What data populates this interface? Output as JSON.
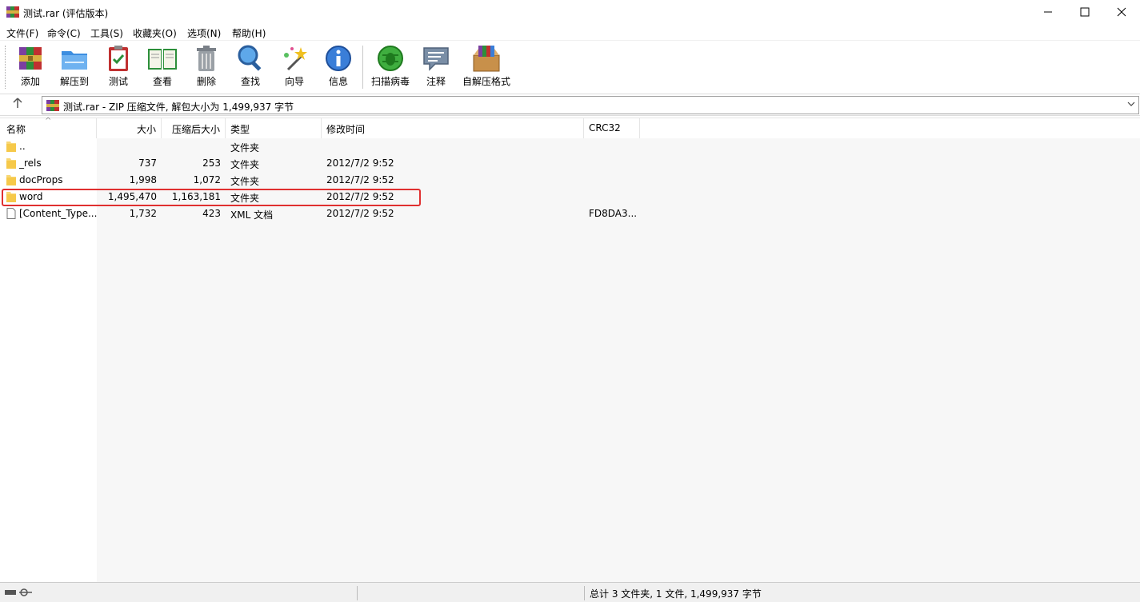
{
  "window": {
    "title": "测试.rar (评估版本)"
  },
  "menu": [
    {
      "label": "文件(F)"
    },
    {
      "label": "命令(C)"
    },
    {
      "label": "工具(S)"
    },
    {
      "label": "收藏夹(O)"
    },
    {
      "label": "选项(N)"
    },
    {
      "label": "帮助(H)"
    }
  ],
  "toolbar": [
    {
      "label": "添加",
      "icon": "add-archive-icon"
    },
    {
      "label": "解压到",
      "icon": "extract-folder-icon"
    },
    {
      "label": "测试",
      "icon": "test-clipboard-icon"
    },
    {
      "label": "查看",
      "icon": "view-book-icon"
    },
    {
      "label": "删除",
      "icon": "trash-icon"
    },
    {
      "label": "查找",
      "icon": "magnifier-icon"
    },
    {
      "label": "向导",
      "icon": "wizard-wand-icon"
    },
    {
      "label": "信息",
      "icon": "info-icon"
    },
    {
      "label": "扫描病毒",
      "icon": "virus-scan-icon"
    },
    {
      "label": "注释",
      "icon": "comment-icon"
    },
    {
      "label": "自解压格式",
      "icon": "sfx-box-icon"
    }
  ],
  "address": {
    "text": "测试.rar - ZIP 压缩文件, 解包大小为 1,499,937 字节"
  },
  "columns": {
    "name": "名称",
    "size": "大小",
    "packed": "压缩后大小",
    "type": "类型",
    "modified": "修改时间",
    "crc": "CRC32"
  },
  "rows": [
    {
      "name": "..",
      "size": "",
      "packed": "",
      "type": "文件夹",
      "modified": "",
      "crc": "",
      "kind": "folder"
    },
    {
      "name": "_rels",
      "size": "737",
      "packed": "253",
      "type": "文件夹",
      "modified": "2012/7/2 9:52",
      "crc": "",
      "kind": "folder"
    },
    {
      "name": "docProps",
      "size": "1,998",
      "packed": "1,072",
      "type": "文件夹",
      "modified": "2012/7/2 9:52",
      "crc": "",
      "kind": "folder"
    },
    {
      "name": "word",
      "size": "1,495,470",
      "packed": "1,163,181",
      "type": "文件夹",
      "modified": "2012/7/2 9:52",
      "crc": "",
      "kind": "folder"
    },
    {
      "name": "[Content_Type...",
      "size": "1,732",
      "packed": "423",
      "type": "XML 文档",
      "modified": "2012/7/2 9:52",
      "crc": "FD8DA3...",
      "kind": "file"
    }
  ],
  "status": {
    "text": "总计 3 文件夹, 1 文件, 1,499,937 字节"
  },
  "colors": {
    "highlight_border": "#e03030",
    "folder": "#f8d775"
  }
}
